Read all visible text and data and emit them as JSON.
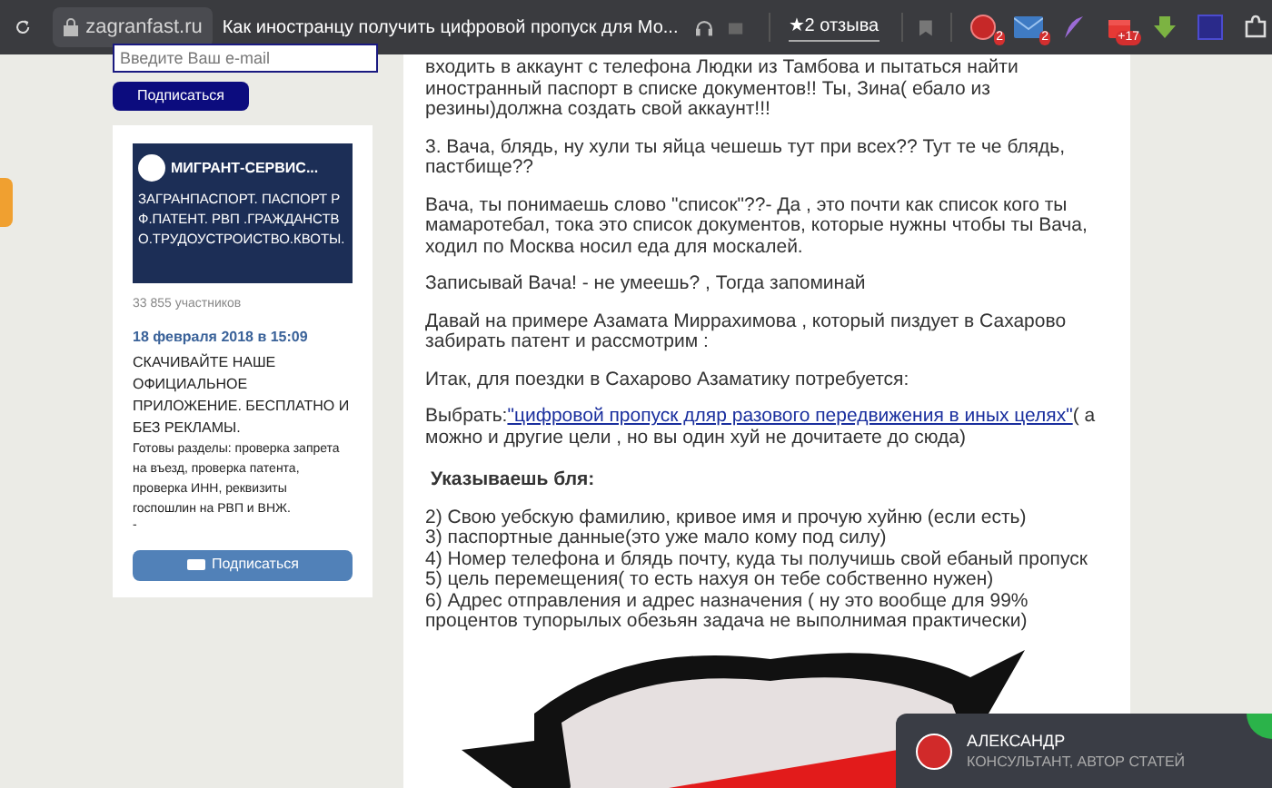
{
  "browser": {
    "url": "zagranfast.ru",
    "tab_title": "Как иностранцу получить цифровой пропуск для Мо...",
    "reviews": "★2 отзыва",
    "extensions": [
      {
        "kind": "ae",
        "badge": "2"
      },
      {
        "kind": "mail",
        "badge": "2"
      },
      {
        "kind": "feather"
      },
      {
        "kind": "gift",
        "badge": "+17"
      },
      {
        "kind": "download"
      },
      {
        "kind": "square"
      },
      {
        "kind": "puzzle"
      }
    ]
  },
  "subscribe_form": {
    "placeholder": "Введите Ваш e-mail",
    "button": "Подписаться"
  },
  "vk_widget": {
    "group_name": "МИГРАНТ-СЕРВИС...",
    "cover_text": "ЗАГРАНПАСПОРТ. ПАСПОРТ РФ.ПАТЕНТ. РВП .ГРАЖДАНСТВО.ТРУДОУСТРОИСТВО.КВОТЫ.",
    "members": "33 855 участников",
    "post_date": "18 февраля 2018 в 15:09",
    "post_title": "СКАЧИВАЙТЕ НАШЕ ОФИЦИАЛЬНОЕ ПРИЛОЖЕНИЕ. БЕСПЛАТНО И БЕЗ РЕКЛАМЫ.",
    "post_text": "Готовы разделы: проверка запрета на въезд, проверка патента, проверка ИНН, реквизиты госпошлин на РВП и ВНЖ.",
    "post_more": "-",
    "button": "Подписаться"
  },
  "article": [
    {
      "kind": "text",
      "text": "входить в аккаунт с телефона Людки из Тамбова и пытаться найти иностранный паспорт в списке документов!! Ты, Зина( ебало из резины)должна создать свой аккаунт!!!"
    },
    {
      "kind": "text",
      "text": "3. Вача, блядь, ну хули ты яйца чешешь тут при всех?? Тут те че блядь, пастбище??"
    },
    {
      "kind": "text",
      "text": "Вача, ты понимаешь слово \"список\"??- Да , это почти как список кого ты мамаротебал, тока это список документов, которые нужны чтобы ты Вача, ходил по Москва носил еда для москалей."
    },
    {
      "kind": "text",
      "text": "Записывай Вача! - не умеешь?  , Тогда запоминай"
    },
    {
      "kind": "text",
      "text": "Давай на примере Азамата Миррахимова , который пиздует в Сахарово забирать патент и рассмотрим :"
    },
    {
      "kind": "text",
      "text": "Итак, для поездки в Сахарово Азаматику потребуется:"
    },
    {
      "kind": "link",
      "prefix": "Выбрать:",
      "link": "\"цифровой пропуск дляр разового передвижения в иных целях\"",
      "suffix": "( а можно и другие цели , но вы один хуй не дочитаете до сюда)"
    },
    {
      "kind": "heading",
      "text": "Указываешь бля:"
    },
    {
      "kind": "list",
      "items": [
        "2) Свою уебскую фамилию, кривое имя и прочую хуйню  (если есть)",
        "3) паспортные данные(это уже мало кому под силу)",
        "4) Номер телефона и блядь почту, куда ты получишь свой ебаный пропуск",
        "5) цель перемещения( то есть нахуя он тебе собственно нужен)",
        "6) Адрес отправления и адрес назначения ( ну это вообще для 99% процентов тупорылых обезьян задача не выполнимая практически)"
      ]
    },
    {
      "kind": "image"
    }
  ],
  "chat": {
    "name": "АЛЕКСАНДР",
    "role": "КОНСУЛЬТАНТ, АВТОР СТАТЕЙ"
  }
}
